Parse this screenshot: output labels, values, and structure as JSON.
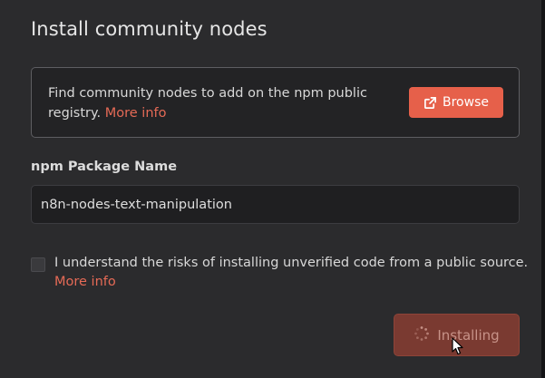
{
  "dialog": {
    "title": "Install community nodes"
  },
  "info": {
    "text": "Find community nodes to add on the npm public registry.",
    "more_info": "More info",
    "browse_label": "Browse",
    "browse_icon": "external-link-icon"
  },
  "package_field": {
    "label": "npm Package Name",
    "value": "n8n-nodes-text-manipulation"
  },
  "risk": {
    "checked": false,
    "text": "I understand the risks of installing unverified code from a public source.",
    "more_info": "More info"
  },
  "install_button": {
    "label": "Installing",
    "state": "loading",
    "icon": "spinner-icon"
  },
  "colors": {
    "accent": "#e6604a",
    "link": "#e56a56",
    "background": "#2b2b2d"
  }
}
